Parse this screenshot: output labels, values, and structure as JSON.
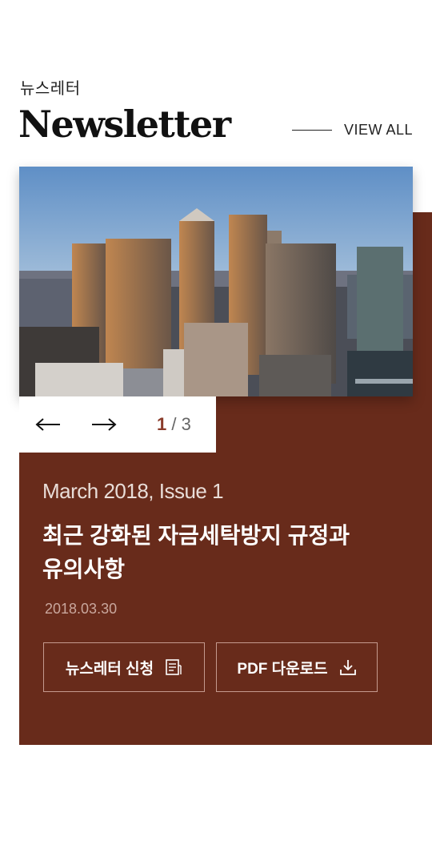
{
  "header": {
    "eyebrow": "뉴스레터",
    "title": "Newsletter",
    "view_all": "VIEW ALL"
  },
  "pager": {
    "current": "1",
    "separator": " / ",
    "total": "3"
  },
  "article": {
    "issue": "March 2018, Issue 1",
    "headline_line1": "최근 강화된 자금세탁방지 규정과",
    "headline_line2": "유의사항",
    "date": "2018.03.30"
  },
  "buttons": {
    "subscribe": "뉴스레터 신청",
    "download": "PDF 다운로드"
  },
  "colors": {
    "card_bg": "#682b1b",
    "pager_accent": "#8a3b2a"
  },
  "icons": [
    "arrow-left-icon",
    "arrow-right-icon",
    "document-icon",
    "download-icon"
  ]
}
